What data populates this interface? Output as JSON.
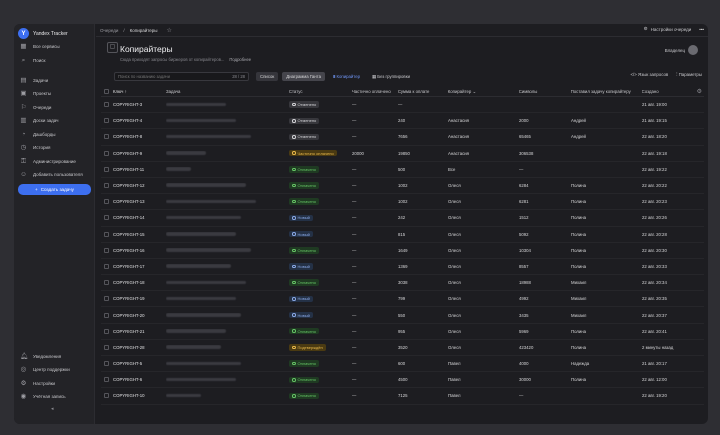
{
  "app": {
    "brand": "Yandex Tracker",
    "brand_initial": "Y"
  },
  "sidebar": {
    "top": [
      {
        "icon": "grid-icon",
        "glyph": "▦",
        "label": "Все сервисы"
      },
      {
        "icon": "search-icon",
        "glyph": "⌕",
        "label": "Поиск"
      }
    ],
    "nav": [
      {
        "icon": "tasks-icon",
        "glyph": "▤",
        "label": "Задачи"
      },
      {
        "icon": "projects-icon",
        "glyph": "▣",
        "label": "Проекты"
      },
      {
        "icon": "queues-icon",
        "glyph": "⚐",
        "label": "Очереди"
      },
      {
        "icon": "boards-icon",
        "glyph": "▥",
        "label": "Доски задач"
      },
      {
        "icon": "dashboards-icon",
        "glyph": "◔",
        "label": "Дашборды"
      },
      {
        "icon": "history-icon",
        "glyph": "◷",
        "label": "История"
      },
      {
        "icon": "admin-icon",
        "glyph": "⚿",
        "label": "Администрирование"
      },
      {
        "icon": "add-user-icon",
        "glyph": "☺",
        "label": "Добавить пользователя"
      }
    ],
    "create_label": "Создать задачу",
    "bottom": [
      {
        "icon": "bell-icon",
        "glyph": "🔔︎",
        "label": "Уведомления"
      },
      {
        "icon": "support-icon",
        "glyph": "◎",
        "label": "Центр поддержки"
      },
      {
        "icon": "gear-icon",
        "glyph": "⚙",
        "label": "Настройки"
      },
      {
        "icon": "account-icon",
        "glyph": "◉",
        "label": "Учётная запись"
      }
    ],
    "collapse_glyph": "◂"
  },
  "header": {
    "breadcrumbs": [
      "Очереди",
      "Копирайтеры"
    ],
    "separator": "/",
    "queue_settings": "Настройки очереди",
    "more": "•••"
  },
  "page": {
    "title": "Копирайтеры",
    "subtitle": "Сюда приходят запросы биржеров от копирайтеров...",
    "more_link": "Подробнее",
    "owner": "Владелец"
  },
  "toolbar": {
    "search_placeholder": "Поиск по названию задачи",
    "count": "28 / 28",
    "views": [
      "Список",
      "Диаграмма Ганта",
      "Копирайтер",
      "Без группировки"
    ],
    "query_lang": "Язык запросов",
    "params": "Параметры"
  },
  "table": {
    "columns": [
      "Ключ",
      "Задача",
      "Статус",
      "Частично оплачено",
      "Сумма к оплате",
      "Копирайтер",
      "Символы",
      "Поставил задачу копирайтеру",
      "Создано"
    ],
    "rows": [
      {
        "key": "COPYRIGHT-3",
        "status": "Отменено",
        "st": "canceled",
        "partial": "—",
        "sum": "—",
        "copywriter": "",
        "symbols": "",
        "assigner": "",
        "created": "21 авг. 19:00",
        "w": 60
      },
      {
        "key": "COPYRIGHT-4",
        "status": "Отменено",
        "st": "canceled",
        "partial": "—",
        "sum": "240",
        "copywriter": "Анастасия",
        "symbols": "2000",
        "assigner": "Андрей",
        "created": "21 авг. 19:15",
        "w": 70
      },
      {
        "key": "COPYRIGHT-8",
        "status": "Отменено",
        "st": "canceled",
        "partial": "—",
        "sum": "7656",
        "copywriter": "Анастасия",
        "symbols": "65465",
        "assigner": "Андрей",
        "created": "22 авг. 18:20",
        "w": 85
      },
      {
        "key": "COPYRIGHT-9",
        "status": "Частично оплачено",
        "st": "partial",
        "partial": "20000",
        "sum": "19850",
        "copywriter": "Анастасия",
        "symbols": "306538",
        "assigner": "",
        "created": "22 авг. 19:18",
        "w": 40
      },
      {
        "key": "COPYRIGHT-11",
        "status": "Оплачено",
        "st": "paid",
        "partial": "—",
        "sum": "500",
        "copywriter": "Все",
        "symbols": "—",
        "assigner": "",
        "created": "22 авг. 19:22",
        "w": 25
      },
      {
        "key": "COPYRIGHT-12",
        "status": "Оплачено",
        "st": "paid",
        "partial": "—",
        "sum": "1002",
        "copywriter": "Олеся",
        "symbols": "6284",
        "assigner": "Полина",
        "created": "22 авг. 20:22",
        "w": 80
      },
      {
        "key": "COPYRIGHT-13",
        "status": "Оплачено",
        "st": "paid",
        "partial": "—",
        "sum": "1002",
        "copywriter": "Олеся",
        "symbols": "6281",
        "assigner": "Полина",
        "created": "22 авг. 20:23",
        "w": 90
      },
      {
        "key": "COPYRIGHT-14",
        "status": "Новый",
        "st": "new",
        "partial": "—",
        "sum": "242",
        "copywriter": "Олеся",
        "symbols": "1512",
        "assigner": "Полина",
        "created": "22 авг. 20:26",
        "w": 75
      },
      {
        "key": "COPYRIGHT-15",
        "status": "Новый",
        "st": "new",
        "partial": "—",
        "sum": "815",
        "copywriter": "Олеся",
        "symbols": "5092",
        "assigner": "Полина",
        "created": "22 авг. 20:28",
        "w": 70
      },
      {
        "key": "COPYRIGHT-16",
        "status": "Оплачено",
        "st": "paid",
        "partial": "—",
        "sum": "1649",
        "copywriter": "Олеся",
        "symbols": "10304",
        "assigner": "Полина",
        "created": "22 авг. 20:30",
        "w": 85
      },
      {
        "key": "COPYRIGHT-17",
        "status": "Новый",
        "st": "new",
        "partial": "—",
        "sum": "1369",
        "copywriter": "Олеся",
        "symbols": "8557",
        "assigner": "Полина",
        "created": "22 авг. 20:33",
        "w": 65
      },
      {
        "key": "COPYRIGHT-18",
        "status": "Оплачено",
        "st": "paid",
        "partial": "—",
        "sum": "3038",
        "copywriter": "Олеся",
        "symbols": "18988",
        "assigner": "Михаил",
        "created": "22 авг. 20:34",
        "w": 80
      },
      {
        "key": "COPYRIGHT-19",
        "status": "Новый",
        "st": "new",
        "partial": "—",
        "sum": "799",
        "copywriter": "Олеся",
        "symbols": "4992",
        "assigner": "Михаил",
        "created": "22 авг. 20:35",
        "w": 70
      },
      {
        "key": "COPYRIGHT-20",
        "status": "Новый",
        "st": "new",
        "partial": "—",
        "sum": "550",
        "copywriter": "Олеся",
        "symbols": "3435",
        "assigner": "Михаил",
        "created": "22 авг. 20:37",
        "w": 75
      },
      {
        "key": "COPYRIGHT-21",
        "status": "Оплачено",
        "st": "paid",
        "partial": "—",
        "sum": "955",
        "copywriter": "Олеся",
        "symbols": "5969",
        "assigner": "Полина",
        "created": "22 авг. 20:41",
        "w": 60
      },
      {
        "key": "COPYRIGHT-28",
        "status": "Подтверждён",
        "st": "confirmed",
        "partial": "—",
        "sum": "3520",
        "copywriter": "Олеся",
        "symbols": "423420",
        "assigner": "Полина",
        "created": "2 минуты назад",
        "w": 55
      },
      {
        "key": "COPYRIGHT-5",
        "status": "Оплачено",
        "st": "paid",
        "partial": "—",
        "sum": "600",
        "copywriter": "Павел",
        "symbols": "4000",
        "assigner": "Надежда",
        "created": "21 авг. 20:17",
        "w": 75
      },
      {
        "key": "COPYRIGHT-6",
        "status": "Оплачено",
        "st": "paid",
        "partial": "—",
        "sum": "4500",
        "copywriter": "Павел",
        "symbols": "30000",
        "assigner": "Полина",
        "created": "22 авг. 12:00",
        "w": 70
      },
      {
        "key": "COPYRIGHT-10",
        "status": "Оплачено",
        "st": "paid",
        "partial": "—",
        "sum": "7125",
        "copywriter": "Павел",
        "symbols": "—",
        "assigner": "",
        "created": "22 авг. 19:20",
        "w": 35
      }
    ]
  }
}
